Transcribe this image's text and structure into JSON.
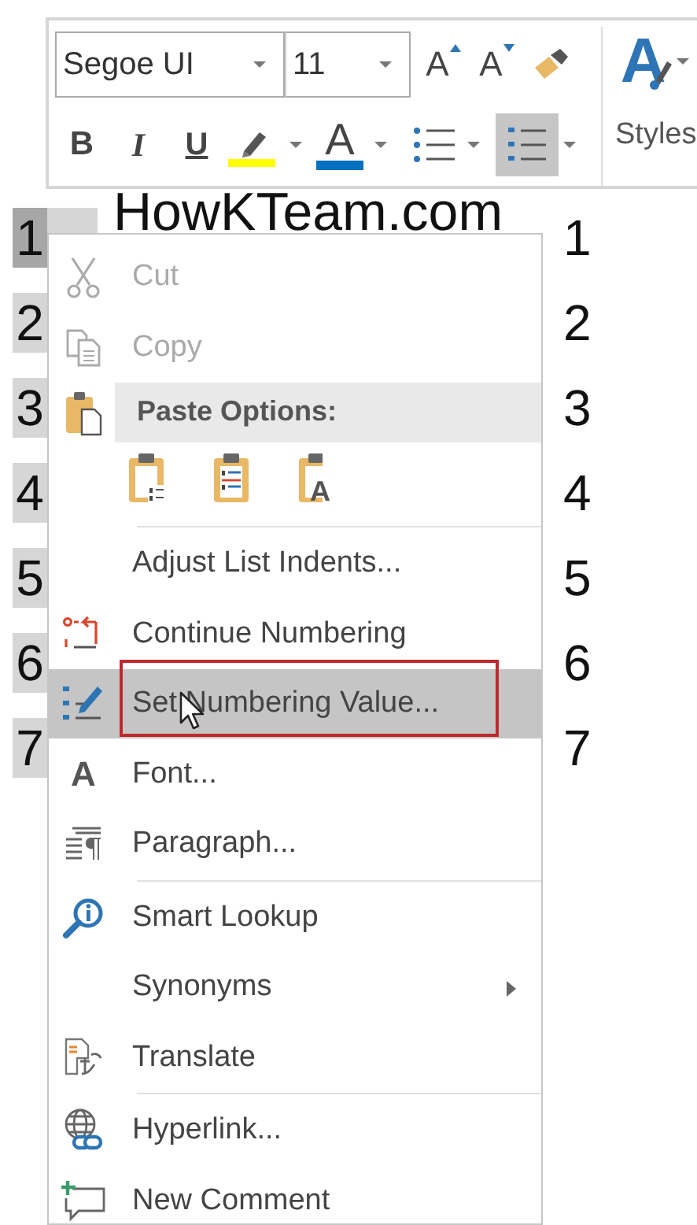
{
  "mini_toolbar": {
    "font_field": {
      "value": "Segoe UI"
    },
    "size_field": {
      "value": "11"
    },
    "row_1": [
      {
        "kind": "grow_font",
        "label": "A"
      },
      {
        "kind": "shrink_font",
        "label": "A"
      },
      {
        "kind": "format_painter"
      }
    ],
    "row_2": [
      {
        "kind": "bold",
        "label": "B",
        "selected": false
      },
      {
        "kind": "italic",
        "label": "I",
        "selected": false
      },
      {
        "kind": "underline",
        "label": "U",
        "selected": false
      },
      {
        "kind": "highlight",
        "color": "#ffff00",
        "selected": false
      },
      {
        "kind": "font_color",
        "label": "A",
        "color": "#0070c0",
        "selected": false
      },
      {
        "kind": "bullets",
        "selected": false
      },
      {
        "kind": "numbering",
        "selected": true
      }
    ],
    "styles": {
      "icon_label": "A",
      "label": "Styles"
    }
  },
  "document": {
    "lines": [
      {
        "number": "1",
        "selected": true,
        "text": "HowKTeam.com",
        "column_3": "1"
      },
      {
        "number": "2",
        "selected": false,
        "column_3": "2"
      },
      {
        "number": "3",
        "selected": false,
        "column_3": "3"
      },
      {
        "number": "4",
        "selected": false,
        "column_3": "4"
      },
      {
        "number": "5",
        "selected": false,
        "column_3": "5"
      },
      {
        "number": "6",
        "selected": false,
        "column_3": "6"
      },
      {
        "number": "7",
        "selected": false,
        "column_3": "7"
      }
    ]
  },
  "context_menu": {
    "items": [
      {
        "kind": "item",
        "label": "Cut",
        "disabled": true,
        "selected": false,
        "outlined": false,
        "pointer": false,
        "submenu": false
      },
      {
        "kind": "item",
        "label": "Copy",
        "disabled": true,
        "selected": false,
        "outlined": false,
        "pointer": false,
        "submenu": false
      },
      {
        "kind": "header",
        "label": "Paste Options:"
      },
      {
        "kind": "paste_buttons",
        "buttons": [
          {
            "kind": "merge_list"
          },
          {
            "kind": "new_list"
          },
          {
            "kind": "text_only",
            "label": "A"
          }
        ]
      },
      {
        "kind": "separator"
      },
      {
        "kind": "item",
        "label": "Adjust List Indents...",
        "disabled": false,
        "selected": false,
        "outlined": false,
        "pointer": false,
        "submenu": false
      },
      {
        "kind": "item",
        "label": "Continue Numbering",
        "disabled": false,
        "selected": false,
        "outlined": false,
        "pointer": false,
        "submenu": false
      },
      {
        "kind": "item",
        "label": "Set Numbering Value...",
        "disabled": false,
        "selected": true,
        "outlined": true,
        "pointer": true,
        "submenu": false
      },
      {
        "kind": "item",
        "icon_text": "A",
        "label": "Font...",
        "disabled": false,
        "selected": false,
        "outlined": false,
        "pointer": false,
        "submenu": false
      },
      {
        "kind": "item",
        "label": "Paragraph...",
        "disabled": false,
        "selected": false,
        "outlined": false,
        "pointer": false,
        "submenu": false
      },
      {
        "kind": "separator"
      },
      {
        "kind": "item",
        "label": "Smart Lookup",
        "disabled": false,
        "selected": false,
        "outlined": false,
        "pointer": false,
        "submenu": false
      },
      {
        "kind": "item",
        "label": "Synonyms",
        "disabled": false,
        "selected": false,
        "outlined": false,
        "pointer": false,
        "submenu": true
      },
      {
        "kind": "item",
        "label": "Translate",
        "disabled": false,
        "selected": false,
        "outlined": false,
        "pointer": false,
        "submenu": false
      },
      {
        "kind": "separator"
      },
      {
        "kind": "item",
        "label": "Hyperlink...",
        "disabled": false,
        "selected": false,
        "outlined": false,
        "pointer": false,
        "submenu": false
      },
      {
        "kind": "item",
        "label": "New Comment",
        "disabled": false,
        "selected": false,
        "outlined": false,
        "pointer": false,
        "submenu": false
      }
    ]
  }
}
